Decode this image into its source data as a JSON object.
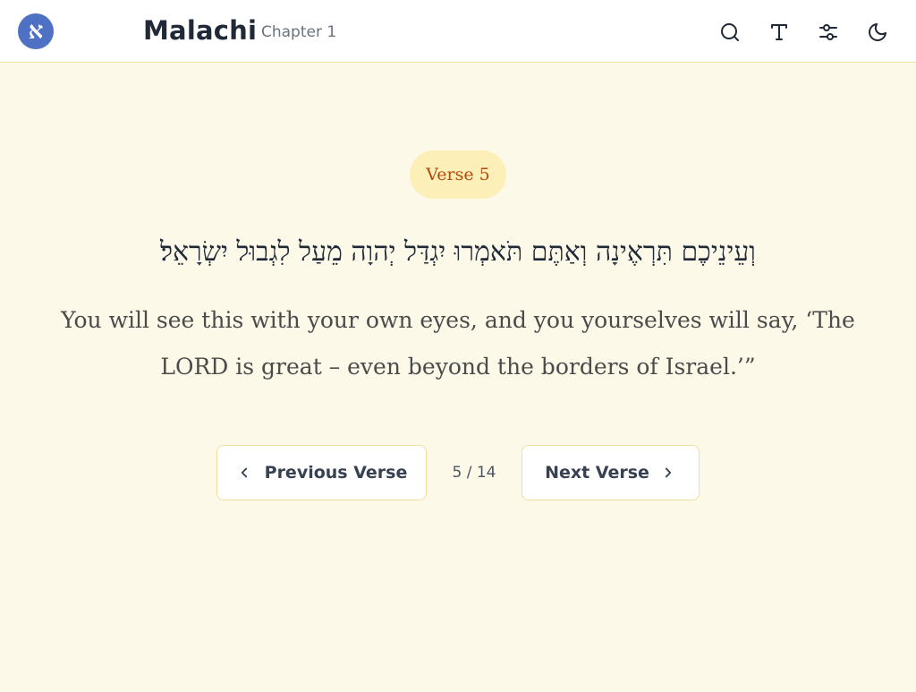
{
  "header": {
    "logo_glyph": "א",
    "book_title": "Malachi",
    "chapter_label": "Chapter 1",
    "icons": [
      "search-icon",
      "font-size-icon",
      "sliders-icon",
      "moon-icon"
    ]
  },
  "verse": {
    "badge": "Verse 5",
    "hebrew": "וְעֵינֵיכֶם תִּרְאֶינָה וְאַתֶּם תֹּאמְרוּ יִגְדַּל יְהוָה מֵעַל לִגְבוּל יִשְׂרָאֵל׃",
    "english": "You will see this with your own eyes, and you yourselves will say, ‘The LORD is great – even beyond the borders of Israel.’”"
  },
  "navigation": {
    "previous_label": "Previous Verse",
    "next_label": "Next Verse",
    "counter": "5 / 14"
  },
  "colors": {
    "background": "#fdf9e9",
    "logo": "#4f71c4",
    "badge_bg": "#fcefb8",
    "badge_text": "#b24c0c"
  }
}
